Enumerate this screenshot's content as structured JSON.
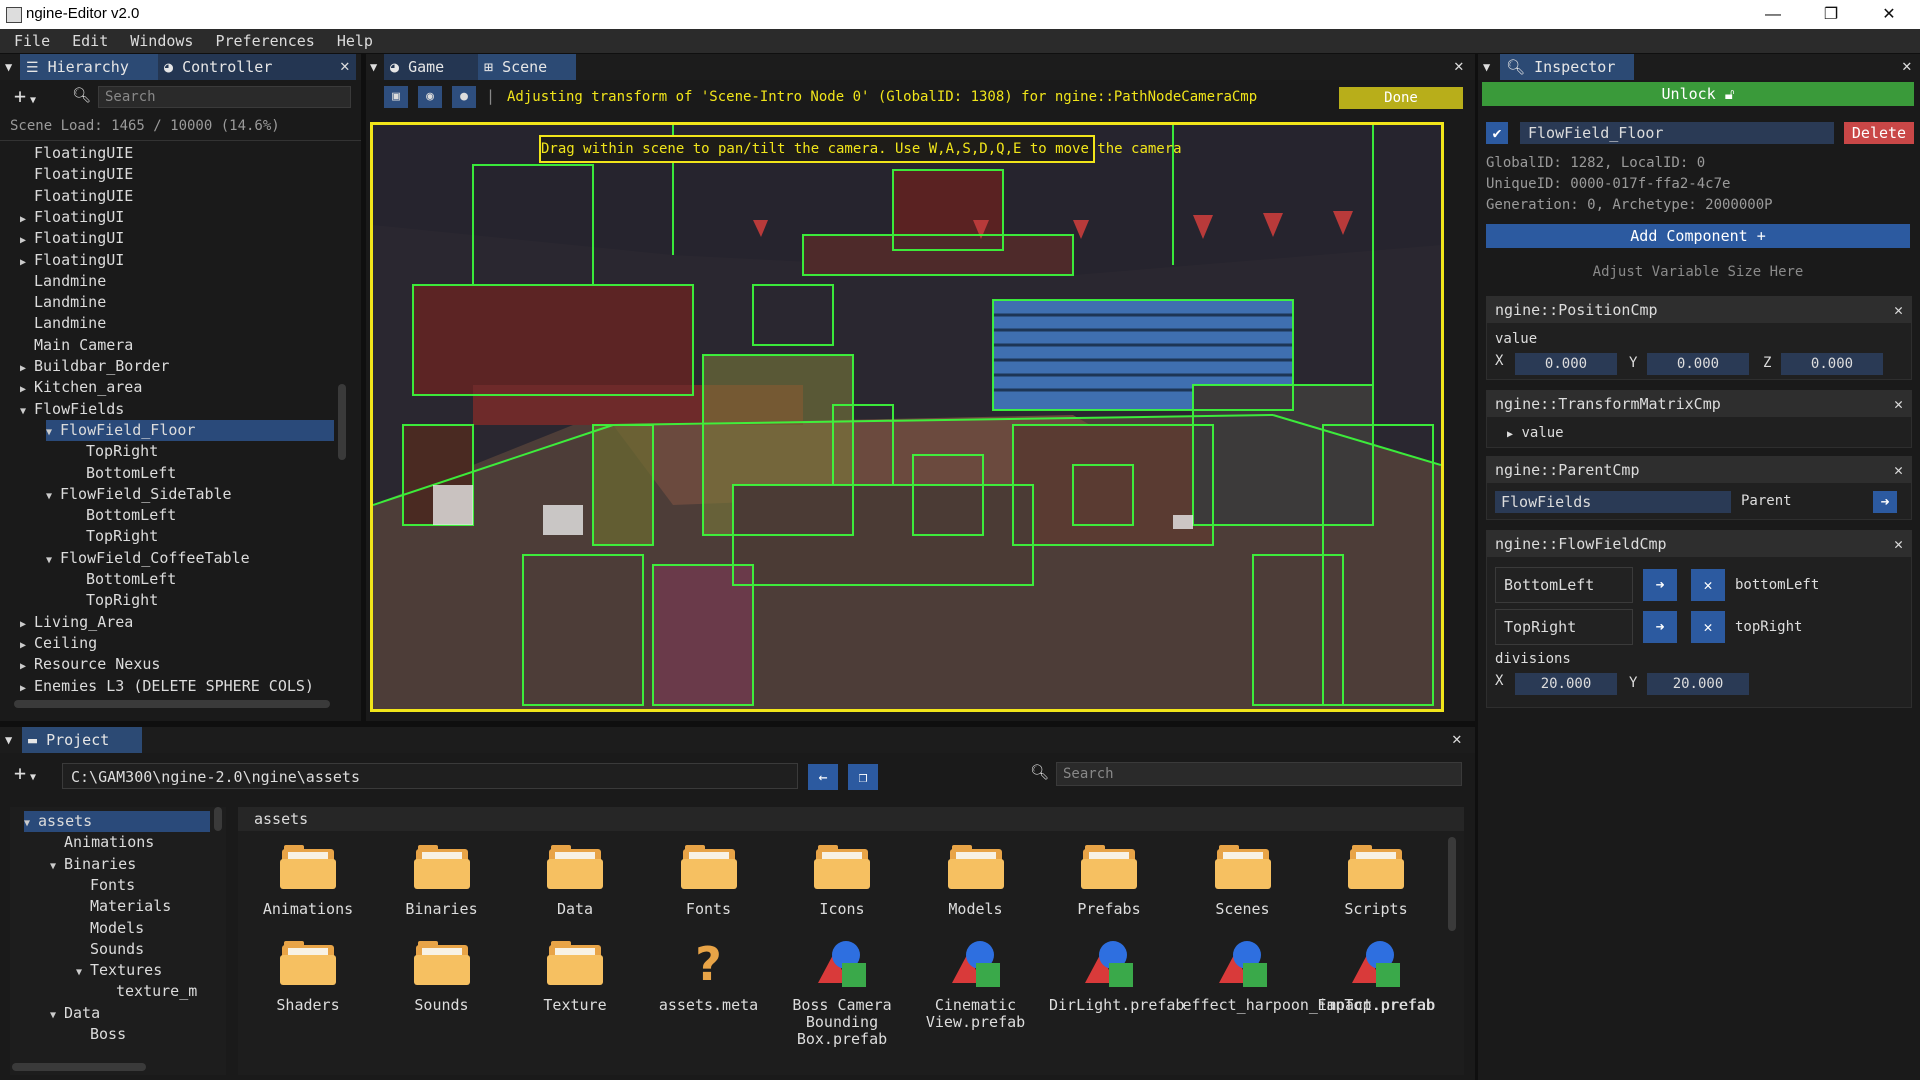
{
  "window": {
    "title": "ngine-Editor v2.0",
    "min": "—",
    "restore": "❐",
    "close": "✕"
  },
  "menu": [
    "File",
    "Edit",
    "Windows",
    "Preferences",
    "Help"
  ],
  "hierarchy": {
    "tab_hierarchy": "Hierarchy",
    "tab_controller": "Controller",
    "search_placeholder": "Search",
    "scene_load": "Scene Load: 1465 / 10000 (14.6%)",
    "items": [
      {
        "label": "FloatingUIE",
        "depth": 0,
        "arrow": ""
      },
      {
        "label": "FloatingUIE",
        "depth": 0,
        "arrow": ""
      },
      {
        "label": "FloatingUIE",
        "depth": 0,
        "arrow": ""
      },
      {
        "label": "FloatingUI",
        "depth": 0,
        "arrow": "▶"
      },
      {
        "label": "FloatingUI",
        "depth": 0,
        "arrow": "▶"
      },
      {
        "label": "FloatingUI",
        "depth": 0,
        "arrow": "▶"
      },
      {
        "label": "Landmine",
        "depth": 0,
        "arrow": ""
      },
      {
        "label": "Landmine",
        "depth": 0,
        "arrow": ""
      },
      {
        "label": "Landmine",
        "depth": 0,
        "arrow": ""
      },
      {
        "label": "Main Camera",
        "depth": 0,
        "arrow": ""
      },
      {
        "label": "Buildbar_Border",
        "depth": 0,
        "arrow": "▶"
      },
      {
        "label": "Kitchen_area",
        "depth": 0,
        "arrow": "▶"
      },
      {
        "label": "FlowFields",
        "depth": 0,
        "arrow": "▼"
      },
      {
        "label": "FlowField_Floor",
        "depth": 1,
        "arrow": "▼",
        "selected": true
      },
      {
        "label": "TopRight",
        "depth": 2,
        "arrow": ""
      },
      {
        "label": "BottomLeft",
        "depth": 2,
        "arrow": ""
      },
      {
        "label": "FlowField_SideTable",
        "depth": 1,
        "arrow": "▼"
      },
      {
        "label": "BottomLeft",
        "depth": 2,
        "arrow": ""
      },
      {
        "label": "TopRight",
        "depth": 2,
        "arrow": ""
      },
      {
        "label": "FlowField_CoffeeTable",
        "depth": 1,
        "arrow": "▼"
      },
      {
        "label": "BottomLeft",
        "depth": 2,
        "arrow": ""
      },
      {
        "label": "TopRight",
        "depth": 2,
        "arrow": ""
      },
      {
        "label": "Living_Area",
        "depth": 0,
        "arrow": "▶"
      },
      {
        "label": "Ceiling",
        "depth": 0,
        "arrow": "▶"
      },
      {
        "label": "Resource Nexus",
        "depth": 0,
        "arrow": "▶"
      },
      {
        "label": "Enemies L3 (DELETE SPHERE COLS)",
        "depth": 0,
        "arrow": "▶"
      }
    ]
  },
  "scene": {
    "tab_game": "Game",
    "tab_scene": "Scene",
    "status": "Adjusting transform of 'Scene-Intro Node 0' (GlobalID: 1308) for ngine::PathNodeCameraCmp",
    "done": "Done",
    "tooltip": "Drag within scene to pan/tilt the camera. Use W,A,S,D,Q,E to move the camera"
  },
  "inspector": {
    "tab": "Inspector",
    "unlock": "Unlock",
    "entity_name": "FlowField_Floor",
    "delete": "Delete",
    "ids": "GlobalID: 1282, LocalID: 0",
    "unique": "UniqueID: 0000-017f-ffa2-4c7e",
    "generation": "Generation: 0, Archetype: 2000000P",
    "add_component": "Add Component +",
    "adjust": "Adjust Variable Size Here",
    "position": {
      "title": "ngine::PositionCmp",
      "label": "value",
      "x": "0.000",
      "y": "0.000",
      "z": "0.000"
    },
    "transform": {
      "title": "ngine::TransformMatrixCmp",
      "label": "value"
    },
    "parent": {
      "title": "ngine::ParentCmp",
      "value": "FlowFields",
      "label": "Parent"
    },
    "flowfield": {
      "title": "ngine::FlowFieldCmp",
      "bl_value": "BottomLeft",
      "bl_label": "bottomLeft",
      "tr_value": "TopRight",
      "tr_label": "topRight",
      "div_label": "divisions",
      "div_x": "20.000",
      "div_y": "20.000"
    },
    "axis": {
      "x": "X",
      "y": "Y",
      "z": "Z"
    }
  },
  "project": {
    "tab": "Project",
    "path": "C:\\GAM300\\ngine-2.0\\ngine\\assets",
    "search_placeholder": "Search",
    "breadcrumb": "assets",
    "tree": [
      {
        "label": "assets",
        "depth": 0,
        "arrow": "▼",
        "selected": true
      },
      {
        "label": "Animations",
        "depth": 1,
        "arrow": ""
      },
      {
        "label": "Binaries",
        "depth": 1,
        "arrow": "▼"
      },
      {
        "label": "Fonts",
        "depth": 2,
        "arrow": ""
      },
      {
        "label": "Materials",
        "depth": 2,
        "arrow": ""
      },
      {
        "label": "Models",
        "depth": 2,
        "arrow": ""
      },
      {
        "label": "Sounds",
        "depth": 2,
        "arrow": ""
      },
      {
        "label": "Textures",
        "depth": 2,
        "arrow": "▼"
      },
      {
        "label": "texture_m",
        "depth": 3,
        "arrow": ""
      },
      {
        "label": "Data",
        "depth": 1,
        "arrow": "▼"
      },
      {
        "label": "Boss",
        "depth": 2,
        "arrow": ""
      }
    ],
    "assets": [
      {
        "name": "Animations",
        "kind": "folder-icon"
      },
      {
        "name": "Binaries",
        "kind": "folder-icon"
      },
      {
        "name": "Data",
        "kind": "folder-icon"
      },
      {
        "name": "Fonts",
        "kind": "folder-icon"
      },
      {
        "name": "Icons",
        "kind": "folder-icon"
      },
      {
        "name": "Models",
        "kind": "folder-icon"
      },
      {
        "name": "Prefabs",
        "kind": "folder-icon"
      },
      {
        "name": "Scenes",
        "kind": "folder-icon"
      },
      {
        "name": "Scripts",
        "kind": "folder-icon"
      },
      {
        "name": "Shaders",
        "kind": "folder-icon"
      },
      {
        "name": "Sounds",
        "kind": "folder-icon"
      },
      {
        "name": "Texture",
        "kind": "folder-icon"
      },
      {
        "name": "assets.meta",
        "kind": "unknown-file-icon"
      },
      {
        "name": "Boss Camera Bounding Box.prefab",
        "kind": "prefab-icon"
      },
      {
        "name": "Cinematic View.prefab",
        "kind": "prefab-icon"
      },
      {
        "name": "DirLight.prefab",
        "kind": "prefab-icon"
      },
      {
        "name": "effect_harpoon_impact.prefab",
        "kind": "prefab-icon"
      },
      {
        "name": "FanTop.prefab",
        "kind": "prefab-icon"
      }
    ]
  },
  "colors": {
    "accent": "#2c5aa0",
    "selection": "#2a4a7a",
    "highlight": "#f1e51a",
    "unlock": "#3a9a3a",
    "delete": "#c94747",
    "wireframe": "#3cff3c"
  }
}
